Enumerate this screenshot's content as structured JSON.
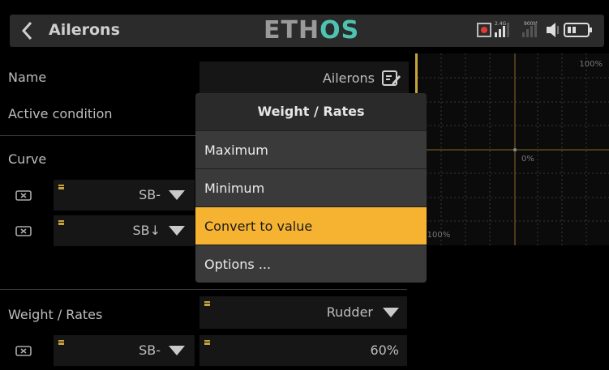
{
  "header": {
    "title": "Ailerons",
    "logo_main": "ETH",
    "logo_accent": "OS",
    "signal_24": "2.4G",
    "signal_900": "900M"
  },
  "form": {
    "name_label": "Name",
    "name_value": "Ailerons",
    "active_condition_label": "Active condition",
    "curve_label": "Curve",
    "curve_rows": [
      {
        "switch": "SB-"
      },
      {
        "switch": "SB↓"
      }
    ],
    "weight_label": "Weight / Rates",
    "weight_source": "Rudder",
    "weight_switch": "SB-",
    "weight_value": "60%"
  },
  "graph": {
    "top_right": "100%",
    "center": "0%",
    "bottom_left": "-100%"
  },
  "popup": {
    "title": "Weight / Rates",
    "options": [
      "Maximum",
      "Minimum",
      "Convert to value",
      "Options ..."
    ],
    "selected_index": 2
  },
  "colors": {
    "accent": "#f6b332",
    "logo_accent": "#4fc3b1",
    "background": "#000000"
  }
}
